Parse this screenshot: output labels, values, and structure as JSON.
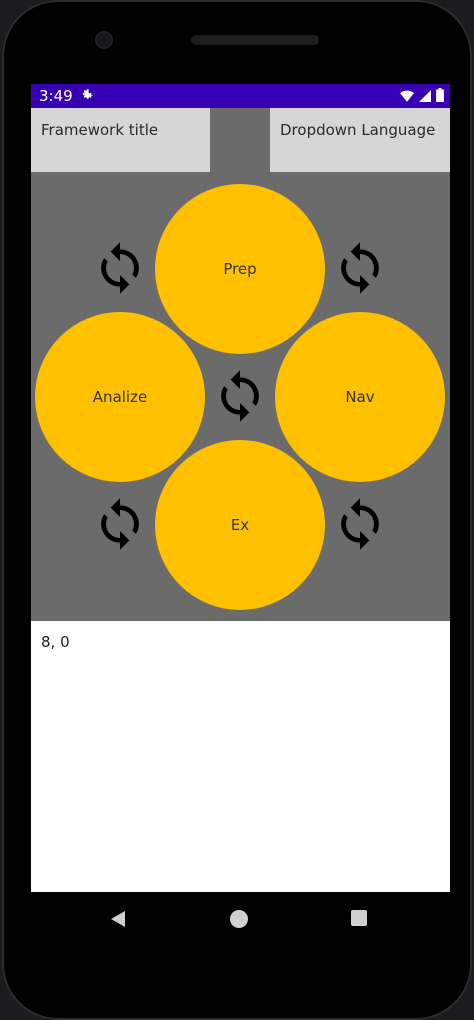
{
  "status": {
    "time": "3:49",
    "icons": [
      "settings-icon",
      "wifi-icon",
      "signal-icon",
      "battery-icon"
    ]
  },
  "header": {
    "framework_title": "Framework title",
    "dropdown_language": "Dropdown Language"
  },
  "phases": {
    "prep": "Prep",
    "analize": "Analize",
    "nav": "Nav",
    "ex": "Ex"
  },
  "sync_icon": "sync-icon",
  "output": {
    "text": "8, 0"
  },
  "colors": {
    "statusbar": "#3700b3",
    "board": "#6b6b6b",
    "circle": "#ffc000",
    "header_box": "#d6d6d6"
  }
}
